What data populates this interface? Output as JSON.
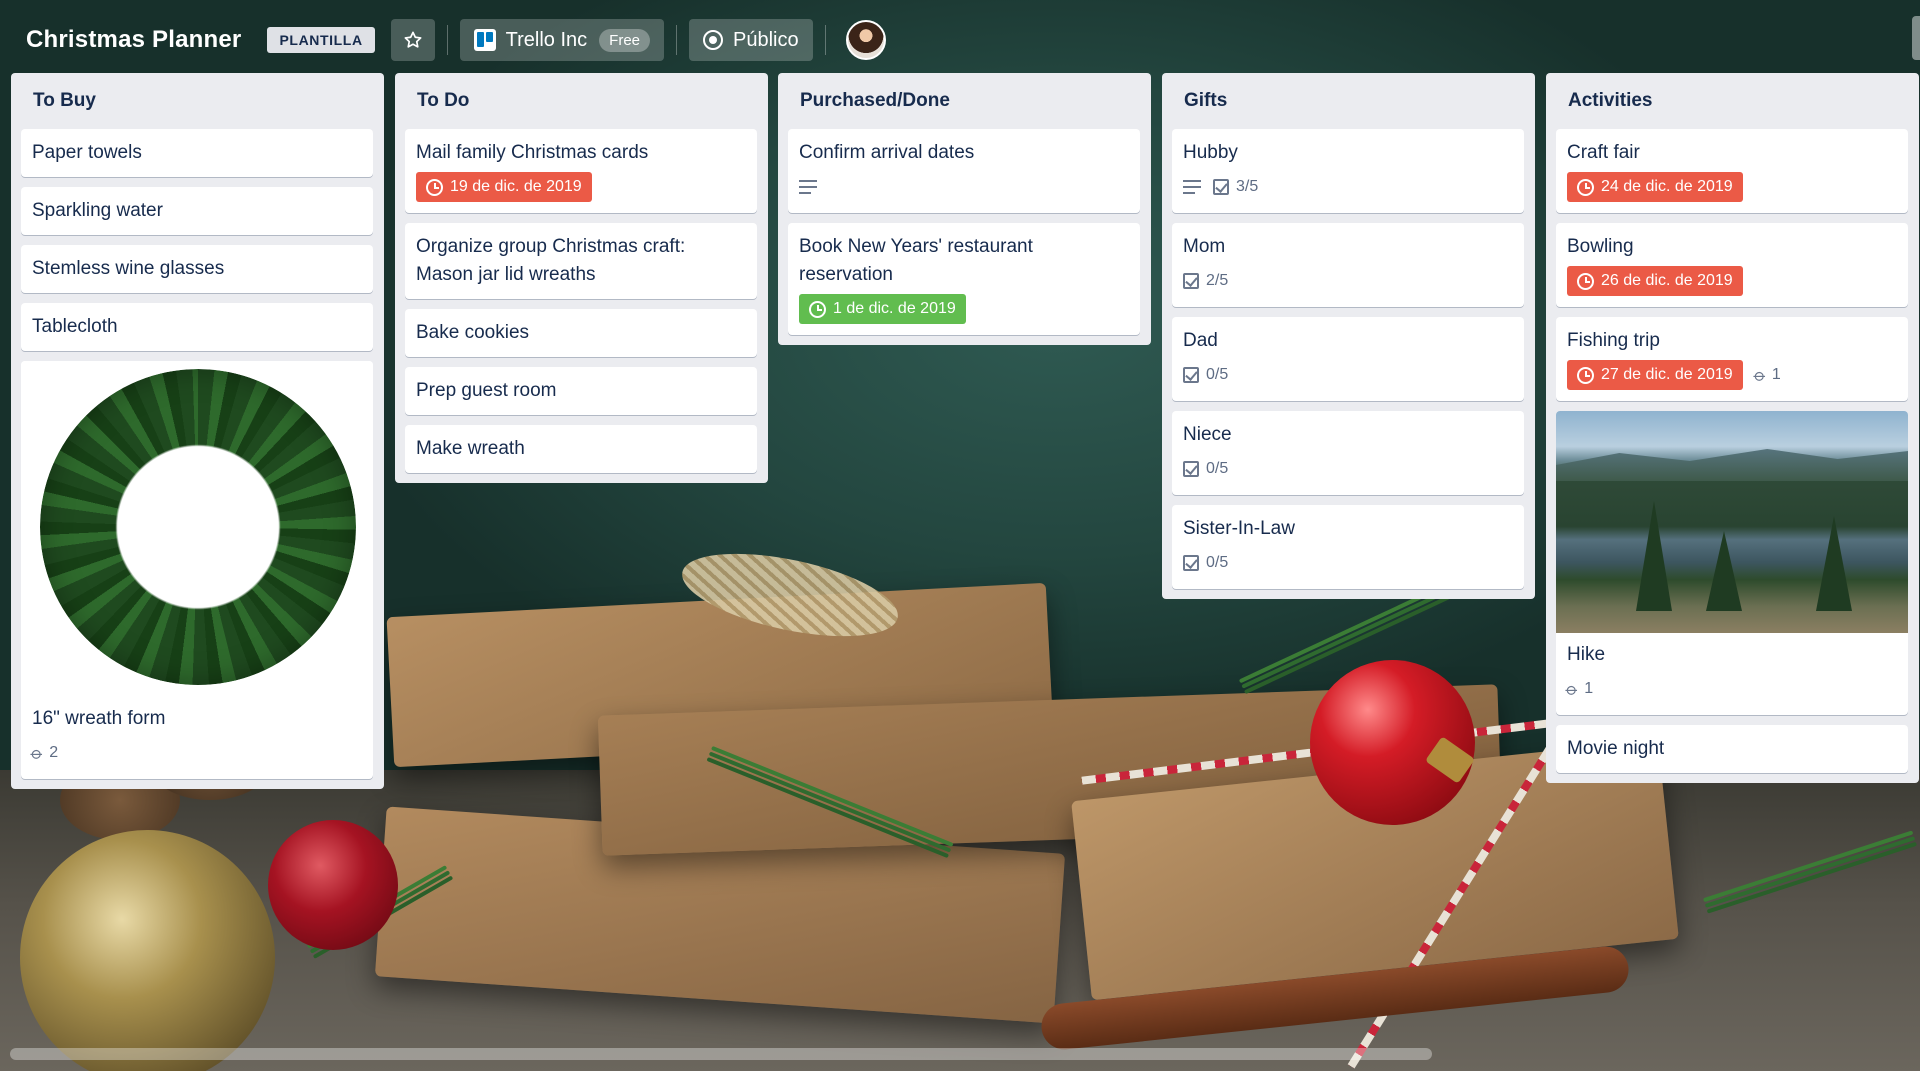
{
  "board": {
    "title": "Christmas Planner",
    "template_badge": "PLANTILLA",
    "team": "Trello Inc",
    "plan": "Free",
    "visibility": "Público"
  },
  "colors": {
    "due_red": "#eb5a46",
    "due_green": "#61bd4f",
    "list_bg": "#ebecf0"
  },
  "lists": [
    {
      "title": "To Buy",
      "cards": [
        {
          "title": "Paper towels"
        },
        {
          "title": "Sparkling water"
        },
        {
          "title": "Stemless wine glasses"
        },
        {
          "title": "Tablecloth"
        },
        {
          "title": "16\" wreath form",
          "cover": "wreath-image",
          "attachments": "2"
        }
      ]
    },
    {
      "title": "To Do",
      "cards": [
        {
          "title": "Mail family Christmas cards",
          "due": "19 de dic. de 2019"
        },
        {
          "title": "Organize group Christmas craft: Mason jar lid wreaths"
        },
        {
          "title": "Bake cookies"
        },
        {
          "title": "Prep guest room"
        },
        {
          "title": "Make wreath"
        }
      ]
    },
    {
      "title": "Purchased/Done",
      "cards": [
        {
          "title": "Confirm arrival dates",
          "description_icon": true
        },
        {
          "title": "Book New Years' restaurant reservation",
          "due": "1 de dic. de 2019",
          "due_complete": true
        }
      ]
    },
    {
      "title": "Gifts",
      "cards": [
        {
          "title": "Hubby",
          "description_icon": true,
          "checklist": "3/5"
        },
        {
          "title": "Mom",
          "checklist": "2/5"
        },
        {
          "title": "Dad",
          "checklist": "0/5"
        },
        {
          "title": "Niece",
          "checklist": "0/5"
        },
        {
          "title": "Sister-In-Law",
          "checklist": "0/5"
        }
      ]
    },
    {
      "title": "Activities",
      "cards": [
        {
          "title": "Craft fair",
          "due": "24 de dic. de 2019"
        },
        {
          "title": "Bowling",
          "due": "26 de dic. de 2019"
        },
        {
          "title": "Fishing trip",
          "due": "27 de dic. de 2019",
          "attachments": "1"
        },
        {
          "title": "Hike",
          "cover": "lake-image",
          "attachments": "1"
        },
        {
          "title": "Movie night"
        }
      ]
    }
  ]
}
